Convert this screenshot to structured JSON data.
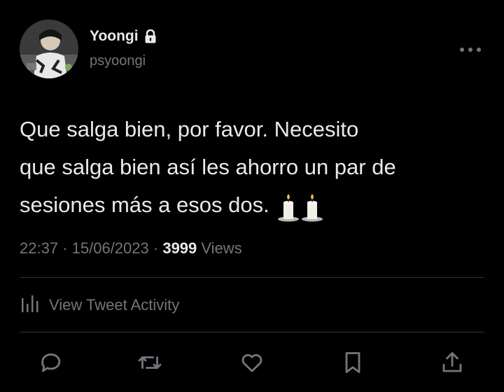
{
  "user": {
    "display_name": "Yoongi",
    "handle": "psyoongi",
    "protected_icon": "lock-icon",
    "avatar": "avatar-photo"
  },
  "tweet": {
    "text": "Que salga bien, por favor. Necesito\nque salga bien así les ahorro un par de\nsesiones más a esos dos.",
    "emoji": [
      "candle",
      "candle"
    ],
    "time": "22:37",
    "separator": "·",
    "date": "15/06/2023",
    "views_count": "3999",
    "views_label": "Views"
  },
  "activity": {
    "label": "View Tweet Activity",
    "icon": "bar-chart-icon"
  },
  "actions": [
    {
      "name": "reply",
      "icon": "speech-bubble-icon"
    },
    {
      "name": "retweet",
      "icon": "retweet-icon"
    },
    {
      "name": "like",
      "icon": "heart-icon"
    },
    {
      "name": "bookmark",
      "icon": "bookmark-icon"
    },
    {
      "name": "share",
      "icon": "share-icon"
    }
  ],
  "colors": {
    "background": "#000000",
    "text": "#e7e9ea",
    "secondary": "#71767b",
    "divider": "#2f3336"
  }
}
